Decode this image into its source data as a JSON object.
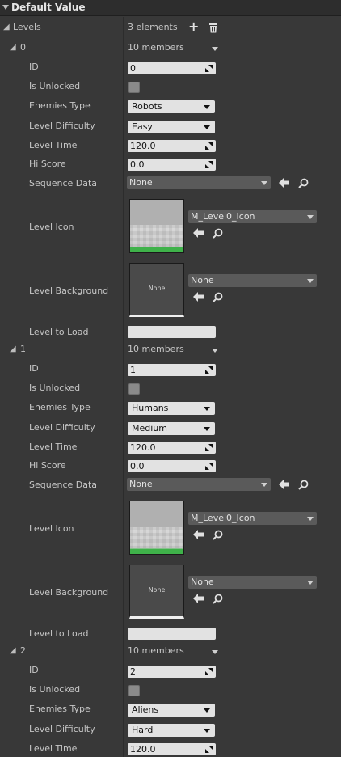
{
  "header": {
    "title": "Default Value"
  },
  "levels": {
    "label": "Levels",
    "count": "3 elements"
  },
  "labels": {
    "id": "ID",
    "unlocked": "Is Unlocked",
    "enemies": "Enemies Type",
    "difficulty": "Level Difficulty",
    "time": "Level Time",
    "score": "Hi Score",
    "sequence": "Sequence Data",
    "icon": "Level Icon",
    "background": "Level Background",
    "toload": "Level to Load",
    "members": "10 members"
  },
  "items": [
    {
      "index": "0",
      "id": "0",
      "is_unlocked": false,
      "enemies_type": "Robots",
      "difficulty": "Easy",
      "time": "120.0",
      "hi_score": "0.0",
      "sequence": "None",
      "icon_asset": "M_Level0_Icon",
      "background_asset": "None",
      "background_thumb": "None",
      "level_to_load": ""
    },
    {
      "index": "1",
      "id": "1",
      "is_unlocked": false,
      "enemies_type": "Humans",
      "difficulty": "Medium",
      "time": "120.0",
      "hi_score": "0.0",
      "sequence": "None",
      "icon_asset": "M_Level0_Icon",
      "background_asset": "None",
      "background_thumb": "None",
      "level_to_load": ""
    },
    {
      "index": "2",
      "id": "2",
      "is_unlocked": false,
      "enemies_type": "Aliens",
      "difficulty": "Hard",
      "time": "120.0"
    }
  ]
}
